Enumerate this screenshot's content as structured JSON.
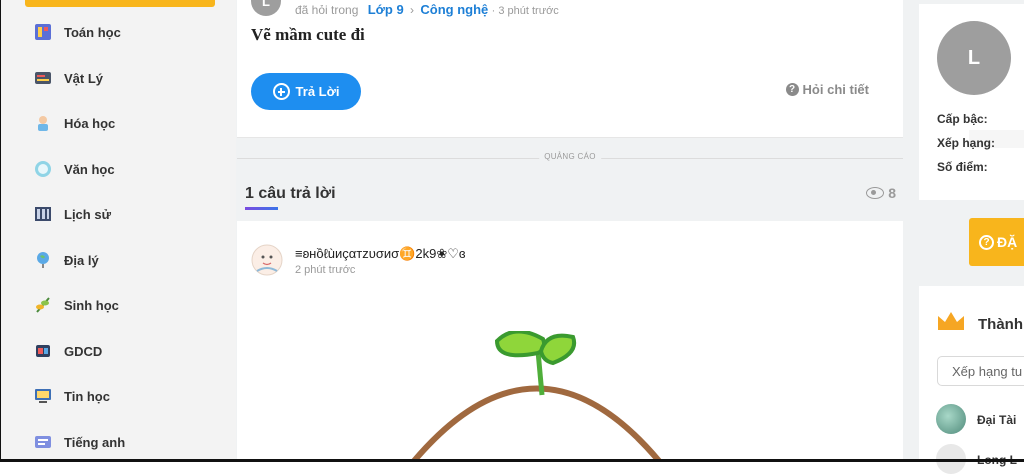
{
  "sidebar": {
    "items": [
      {
        "label": "Toán học",
        "icon": "math-icon"
      },
      {
        "label": "Vật Lý",
        "icon": "physics-icon"
      },
      {
        "label": "Hóa học",
        "icon": "chemistry-icon"
      },
      {
        "label": "Văn học",
        "icon": "literature-icon"
      },
      {
        "label": "Lịch sử",
        "icon": "history-icon"
      },
      {
        "label": "Địa lý",
        "icon": "geography-icon"
      },
      {
        "label": "Sinh học",
        "icon": "biology-icon"
      },
      {
        "label": "GDCD",
        "icon": "civics-icon"
      },
      {
        "label": "Tin học",
        "icon": "informatics-icon"
      },
      {
        "label": "Tiếng anh",
        "icon": "english-icon"
      }
    ]
  },
  "question": {
    "avatar_letter": "L",
    "asked_in": "đã hỏi trong",
    "grade": "Lớp 9",
    "subject": "Công nghệ",
    "time": "· 3 phút trước",
    "title": "Vẽ mầm cute đi",
    "answer_button": "Trả Lời",
    "detail_link": "Hỏi chi tiết"
  },
  "ad_label": "QUẢNG CÁO",
  "answers": {
    "heading": "1 câu trả lời",
    "views": "8",
    "items": [
      {
        "author": "≡ʚнồℓùиçαтzυσиσ♊2k9❀♡ɞ",
        "time": "2 phút trước"
      }
    ]
  },
  "profile": {
    "avatar_letter": "L",
    "rank_label": "Cấp bậc:",
    "position_label": "Xếp hạng:",
    "points_label": "Số điểm:"
  },
  "ask_button": "ĐẶ",
  "leaderboard": {
    "title": "Thành",
    "select_placeholder": "Xếp hạng tu",
    "users": [
      {
        "name": "Đại Tài"
      },
      {
        "name": "Long L"
      }
    ]
  },
  "colors": {
    "accent_blue": "#1e8ef0",
    "accent_orange": "#f8b51c",
    "link_blue": "#1d7fd6"
  }
}
